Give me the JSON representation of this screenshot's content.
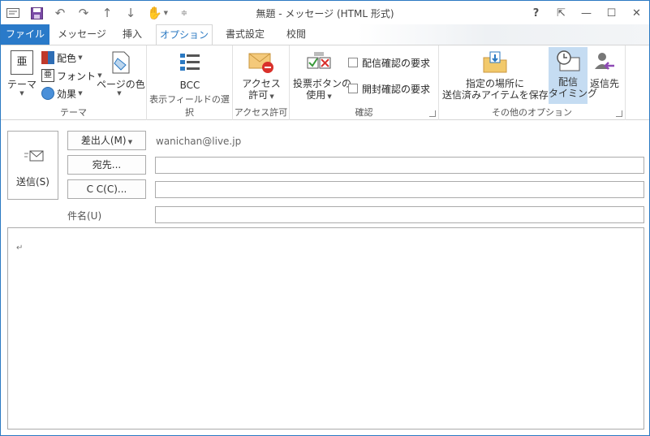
{
  "window": {
    "title": "無題 - メッセージ (HTML 形式)",
    "controls": {
      "help": "?",
      "ribbon_display": "⇱",
      "minimize": "—",
      "maximize": "☐",
      "close": "✕"
    }
  },
  "tabs": [
    {
      "label": "ファイル"
    },
    {
      "label": "メッセージ"
    },
    {
      "label": "挿入"
    },
    {
      "label": "オプション"
    },
    {
      "label": "書式設定"
    },
    {
      "label": "校閲"
    }
  ],
  "ribbon": {
    "theme": {
      "group_label": "テーマ",
      "theme_btn": "テーマ",
      "colors": "配色",
      "fonts": "フォント",
      "effects": "効果",
      "page_color": "ページの色"
    },
    "fields": {
      "group_label": "表示フィールドの選択",
      "bcc": "BCC"
    },
    "permission": {
      "group_label": "アクセス許可",
      "btn_line1": "アクセス",
      "btn_line2": "許可"
    },
    "tracking": {
      "group_label": "確認",
      "vote_line1": "投票ボタンの",
      "vote_line2": "使用",
      "delivery_receipt": "配信確認の要求",
      "read_receipt": "開封確認の要求"
    },
    "more": {
      "group_label": "その他のオプション",
      "save_line1": "指定の場所に",
      "save_line2": "送信済みアイテムを保存",
      "delay_line1": "配信",
      "delay_line2": "タイミング",
      "reply_to": "返信先"
    }
  },
  "compose": {
    "send": "送信(S)",
    "from_btn": "差出人(M)",
    "from_value": "wanichan@live.jp",
    "to_btn": "宛先...",
    "cc_btn": "C C(C)...",
    "subject_label": "件名(U)",
    "to_value": "",
    "cc_value": "",
    "subject_value": "",
    "paragraph_mark": "↵"
  },
  "colors": {
    "accent": "#2b79c2",
    "file_tab": "#2a7ac9",
    "highlight": "#c5dcf2"
  }
}
